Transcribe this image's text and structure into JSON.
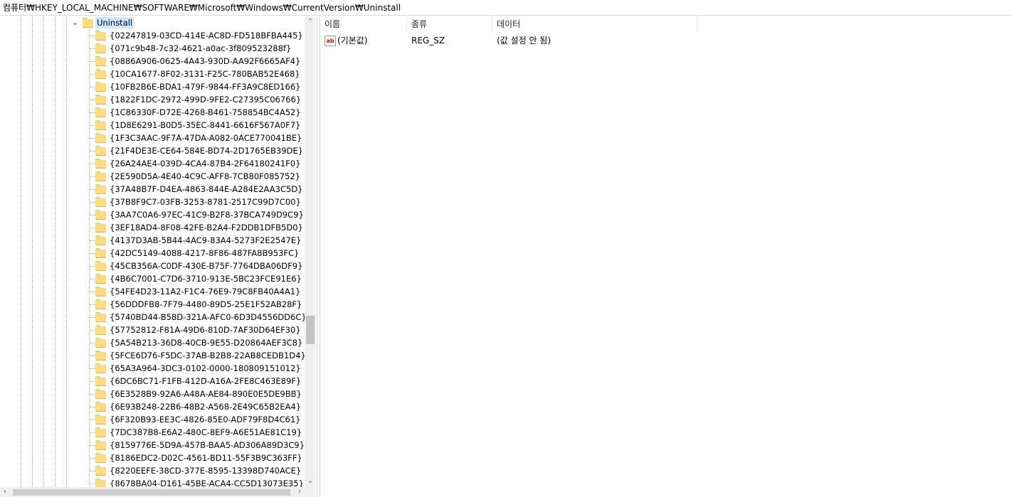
{
  "address_bar": {
    "path": "컴퓨터₩HKEY_LOCAL_MACHINE₩SOFTWARE₩Microsoft₩Windows₩CurrentVersion₩Uninstall"
  },
  "tree": {
    "selected": "Uninstall",
    "children": [
      "{02247819-03CD-414E-AC8D-FD518BFBA445}",
      "{071c9b48-7c32-4621-a0ac-3f809523288f}",
      "{0886A906-0625-4A43-930D-AA92F6665AF4}",
      "{10CA1677-8F02-3131-F25C-780BAB52E468}",
      "{10FB2B6E-BDA1-479F-9844-FF3A9C8ED166}",
      "{1822F1DC-2972-499D-9FE2-C27395C06766}",
      "{1C86330F-D72E-4268-B461-758854BC4A52}",
      "{1D8E6291-B0D5-35EC-8441-6616F567A0F7}",
      "{1F3C3AAC-9F7A-47DA-A082-0ACE770041BE}",
      "{21F4DE3E-CE64-584E-BD74-2D1765EB39DE}",
      "{26A24AE4-039D-4CA4-87B4-2F64180241F0}",
      "{2E590D5A-4E40-4C9C-AFF8-7CB80F085752}",
      "{37A48B7F-D4EA-4863-844E-A284E2AA3C5D}",
      "{37B8F9C7-03FB-3253-8781-2517C99D7C00}",
      "{3AA7C0A6-97EC-41C9-B2F8-37BCA749D9C9}",
      "{3EF18AD4-8F08-42FE-B2A4-F2DDB1DFB5D0}",
      "{4137D3AB-5B44-4AC9-83A4-5273F2E2547E}",
      "{42DC5149-4088-4217-8F86-487FA8B953FC}",
      "{45CB356A-C0DF-430E-B75F-7764DBA06DF9}",
      "{4B6C7001-C7D6-3710-913E-5BC23FCE91E6}",
      "{54FE4D23-11A2-F1C4-76E9-79C8FB40A4A1}",
      "{56DDDFB8-7F79-4480-89D5-25E1F52AB28F}",
      "{5740BD44-B58D-321A-AFC0-6D3D4556DD6C}",
      "{57752812-F81A-49D6-810D-7AF30D64EF30}",
      "{5A54B213-36D8-40CB-9E55-D20864AEF3C8}",
      "{5FCE6D76-F5DC-37AB-B2B8-22AB8CEDB1D4}",
      "{65A3A964-3DC3-0102-0000-180809151012}",
      "{6DC6BC71-F1FB-412D-A16A-2FE8C463E89F}",
      "{6E3528B9-92A6-A48A-AE84-890E0E5DE9BB}",
      "{6E93B248-22B6-48B2-A568-2E49C65B2EA4}",
      "{6F320B93-EE3C-4826-85E0-ADF79F8D4C61}",
      "{7DC387B8-E6A2-480C-8EF9-A6E51AE81C19}",
      "{8159776E-5D9A-457B-BAA5-AD306A89D3C9}",
      "{8186EDC2-D02C-4561-BD11-55F3B9C363FF}",
      "{8220EEFE-38CD-377E-8595-13398D740ACE}",
      "{8678BA04-D161-45BE-ACA4-CC5D13073E35}"
    ]
  },
  "list": {
    "columns": [
      "이름",
      "종류",
      "데이터"
    ],
    "rows": [
      {
        "icon": "string-value-icon",
        "icon_text": "ab",
        "name": "(기본값)",
        "type": "REG_SZ",
        "data": "(값 설정 안 됨)"
      }
    ]
  },
  "colors": {
    "selection": "#cce8ff",
    "folder": "#f8dc80",
    "guide": "#a8a8a8"
  }
}
